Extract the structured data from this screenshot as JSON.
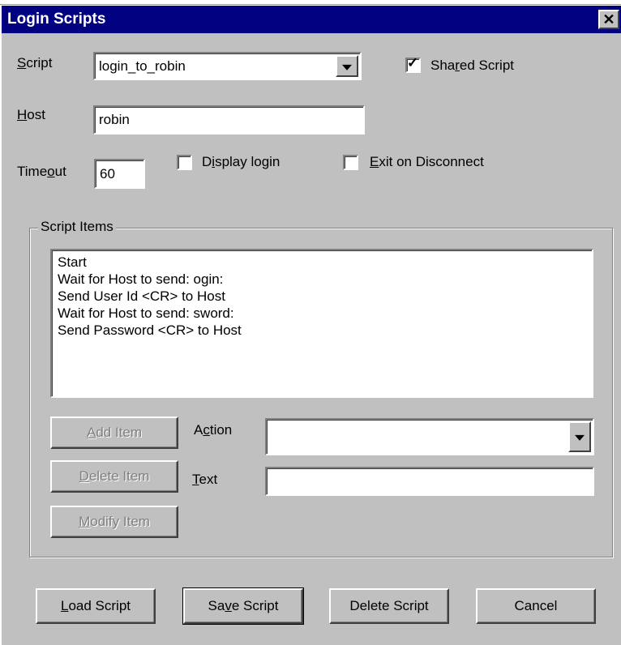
{
  "window": {
    "title": "Login Scripts",
    "close_glyph": "✕",
    "close_icon": "close-icon"
  },
  "script": {
    "label": "Script",
    "value": "login_to_robin",
    "dropdown_icon": "chevron-down-icon"
  },
  "shared_script": {
    "label": "Shared Script",
    "checked": true,
    "mark": "✓"
  },
  "host": {
    "label": "Host",
    "value": "robin"
  },
  "timeout": {
    "label": "Timeout",
    "value": "60"
  },
  "display_login": {
    "label": "Display login",
    "checked": false
  },
  "exit_on_disconnect": {
    "label": "Exit on Disconnect",
    "checked": false
  },
  "script_items": {
    "label": "Script Items",
    "items": [
      "Start",
      "Wait for Host to send: ogin:",
      "Send User Id <CR> to Host",
      "Wait for Host to send: sword:",
      "Send Password <CR> to Host"
    ]
  },
  "item_buttons": {
    "add": "Add Item",
    "delete": "Delete Item",
    "modify": "Modify Item"
  },
  "action": {
    "label": "Action",
    "value": ""
  },
  "text": {
    "label": "Text",
    "value": ""
  },
  "footer": {
    "load": "Load Script",
    "save": "Save Script",
    "delete": "Delete Script",
    "cancel": "Cancel"
  }
}
